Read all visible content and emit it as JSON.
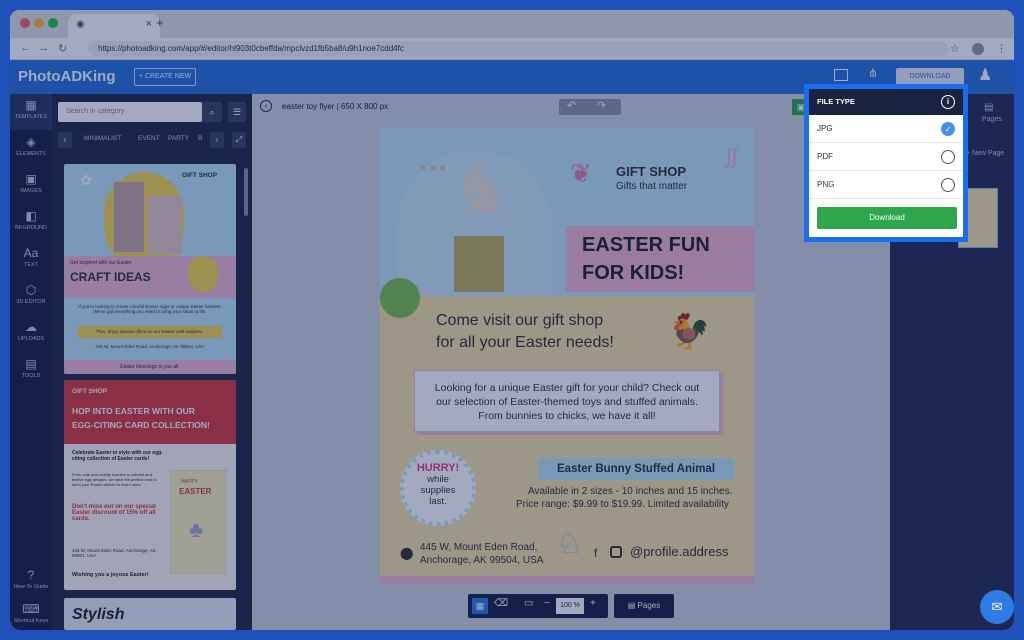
{
  "browser": {
    "url": "https://photoadking.com/app/#/editor/hl903t0cbeffda/mpclvzd1fb5ba8/u9h1noe7cdd4fc",
    "new_tab": "+",
    "tab_close": "×"
  },
  "header": {
    "logo": "PhotoADKing",
    "create_new": "+ CREATE NEW",
    "download": "DOWNLOAD"
  },
  "sidebar": {
    "items": [
      {
        "label": "TEMPLATES",
        "icon": "templates-icon",
        "glyph": "▦"
      },
      {
        "label": "ELEMENTS",
        "icon": "elements-icon",
        "glyph": "◈"
      },
      {
        "label": "IMAGES",
        "icon": "images-icon",
        "glyph": "▣"
      },
      {
        "label": "BKGROUND",
        "icon": "background-icon",
        "glyph": "◧"
      },
      {
        "label": "TEXT",
        "icon": "text-icon",
        "glyph": "Aa"
      },
      {
        "label": "3D EDITOR",
        "icon": "3d-editor-icon",
        "glyph": "⬡"
      },
      {
        "label": "UPLOADS",
        "icon": "uploads-icon",
        "glyph": "☁"
      },
      {
        "label": "TOOLS",
        "icon": "tools-icon",
        "glyph": "▤"
      }
    ],
    "howto": "How-To Guide",
    "shortcuts": "Shortcut Keys"
  },
  "panel": {
    "search_placeholder": "Search in category",
    "categories": [
      "MINIMALIST",
      "EVENT",
      "PARTY",
      "B"
    ],
    "t1": {
      "brand": "GIFT SHOP",
      "small": "Get inspired with our Easter",
      "title": "CRAFT IDEAS",
      "body": "If you're looking to create colorful Easter eggs or unique Easter baskets. We've got everything you need to bring your ideas to life.",
      "promo": "Plus, enjoy special offers on our Easter craft supplies.",
      "address": "445 W, Mount Eden Road, Anchorage, AK 99504, USA",
      "footer": "Easter blessings to you all."
    },
    "t2": {
      "brand": "GIFT SHOP",
      "title1": "HOP INTO EASTER WITH OUR",
      "title2": "EGG-CITING CARD COLLECTION!",
      "lead": "Celebrate Easter in style with our egg-citing collection of Easter cards!",
      "body": "From cute and cuddly bunnies to colorful and festive egg designs, we have the perfect card to send your Easter wishes to loved ones.",
      "promo": "Don't miss out on our special Easter discount of 15% off all cards.",
      "address": "445 W, Mount Eden Road, Anchorage, AK 99504, USA",
      "footer": "Wishing you a joyous Easter!",
      "card1": "HAPPY",
      "card2": "EASTER"
    },
    "t3": {
      "title": "Stylish"
    }
  },
  "canvas": {
    "title": "easter toy flyer",
    "size": "650 X 800 px",
    "flyer": {
      "brand": "GIFT SHOP",
      "tagline": "Gifts that matter",
      "headline1": "EASTER FUN",
      "headline2": "FOR KIDS!",
      "visit1": "Come visit our gift shop",
      "visit2": "for all your Easter needs!",
      "box1": "Looking for a unique Easter gift for your child? Check out",
      "box2": "our selection of Easter-themed toys and stuffed animals.",
      "box3": "From bunnies to chicks, we have it all!",
      "hurry": "HURRY!",
      "badge1": "while",
      "badge2": "supplies",
      "badge3": "last.",
      "product": "Easter Bunny Stuffed Animal",
      "avail": "Available in 2 sizes - 10 inches and 15 inches.",
      "price": "Price range: $9.99 to $19.99. Limited availability",
      "addr1": "445 W, Mount Eden Road,",
      "addr2": "Anchorage, AK 99504, USA",
      "social": "@profile.address"
    },
    "zoom": "100 %",
    "pages_button": "Pages"
  },
  "right_panel": {
    "pages_label": "Pages",
    "new_page": "+ New Page"
  },
  "popup": {
    "title": "FILE TYPE",
    "options": [
      {
        "label": "JPG",
        "selected": true
      },
      {
        "label": "PDF",
        "selected": false
      },
      {
        "label": "PNG",
        "selected": false
      }
    ],
    "download": "Download"
  },
  "colors": {
    "accent": "#1a6cf0",
    "download_green": "#2ea64b",
    "header_blue": "#2b73d8",
    "sidebar_dark": "#1a2340"
  }
}
